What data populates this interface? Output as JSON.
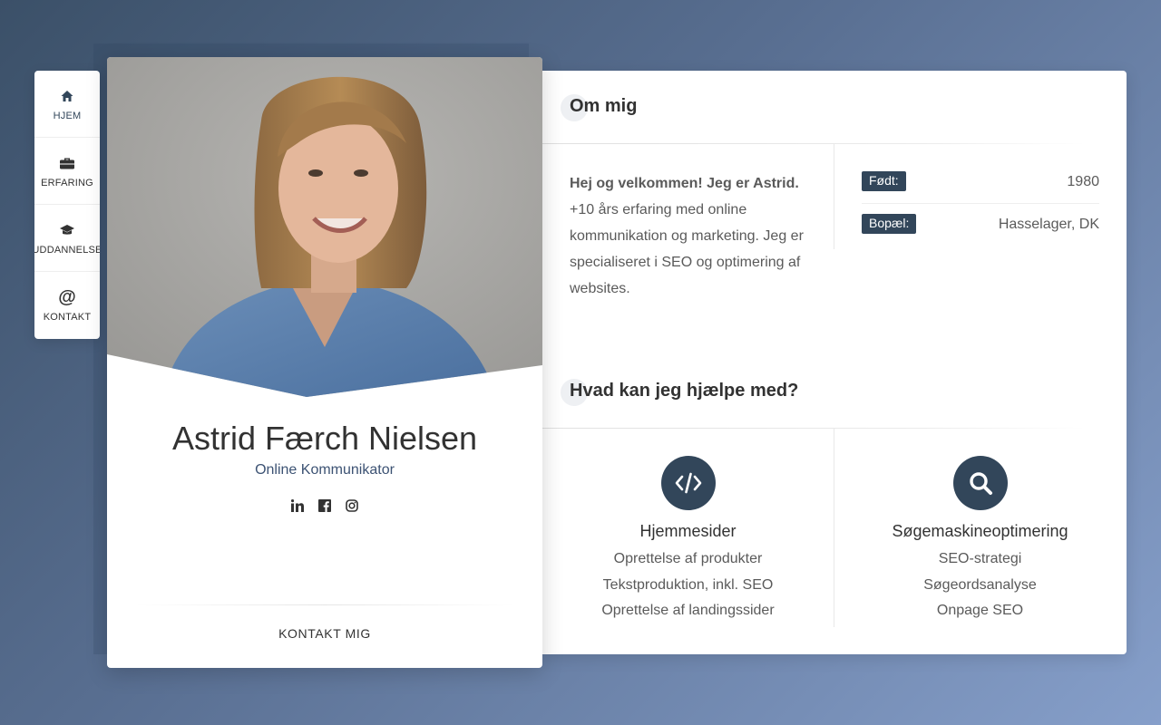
{
  "nav": {
    "items": [
      {
        "label": "HJEM",
        "icon": "home-icon",
        "active": true
      },
      {
        "label": "ERFARING",
        "icon": "briefcase-icon",
        "active": false
      },
      {
        "label": "UDDANNELSE",
        "icon": "graduation-cap-icon",
        "active": false
      },
      {
        "label": "KONTAKT",
        "icon": "at-sign-icon",
        "active": false
      }
    ]
  },
  "profile": {
    "name": "Astrid Færch Nielsen",
    "role": "Online Kommunikator",
    "socials": [
      "linkedin-icon",
      "facebook-icon",
      "instagram-icon"
    ],
    "contact_button": "KONTAKT MIG"
  },
  "about": {
    "title": "Om mig",
    "intro_bold": "Hej og velkommen! Jeg er Astrid.",
    "intro_text": "+10 års erfaring med online kommunikation og marketing. Jeg er specialiseret i SEO og optimering af websites.",
    "facts": [
      {
        "label": "Født:",
        "value": "1980"
      },
      {
        "label": "Bopæl:",
        "value": "Hasselager, DK"
      }
    ]
  },
  "services": {
    "title": "Hvad kan jeg hjælpe med?",
    "items": [
      {
        "icon": "code-icon",
        "title": "Hjemmesider",
        "points": [
          "Oprettelse af produkter",
          "Tekstproduktion, inkl. SEO",
          "Oprettelse af landingssider"
        ]
      },
      {
        "icon": "search-icon",
        "title": "Søgemaskineoptimering",
        "points": [
          "SEO-strategi",
          "Søgeordsanalyse",
          "Onpage SEO"
        ]
      }
    ]
  },
  "colors": {
    "accent": "#32465a",
    "link": "#3c5273",
    "text": "#323232",
    "muted": "#5a5a5a"
  }
}
